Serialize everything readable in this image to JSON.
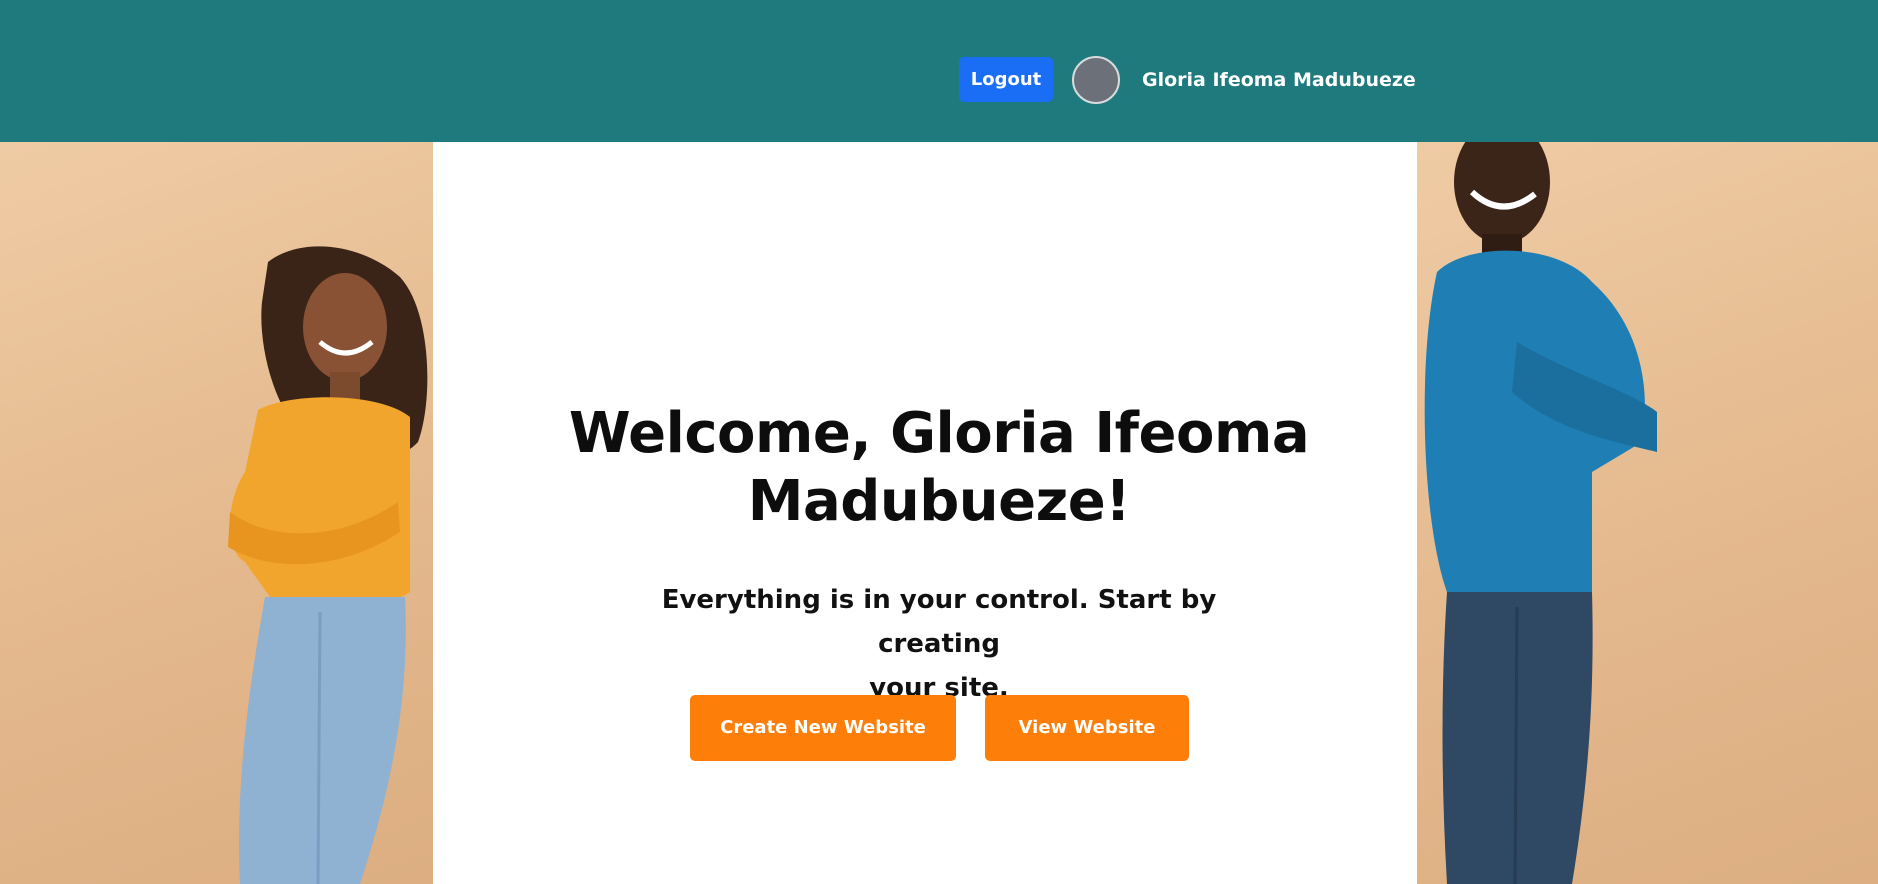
{
  "header": {
    "logout_label": "Logout",
    "user_name": "Gloria Ifeoma Madubueze",
    "background_color": "#1e7a7d",
    "logout_color": "#1a6ef5"
  },
  "main": {
    "welcome_line_1": "Welcome, Gloria Ifeoma",
    "welcome_line_2": "Madubueze!",
    "tagline_line_1": "Everything is in your control. Start by creating",
    "tagline_line_2": "your site.",
    "create_button_label": "Create New Website",
    "view_button_label": "View Website",
    "button_color": "#fd7f0a"
  },
  "images": {
    "left": "photo-woman-yellow-sweater",
    "right": "photo-man-blue-sweater",
    "backdrop_color": "#e4b98d"
  }
}
